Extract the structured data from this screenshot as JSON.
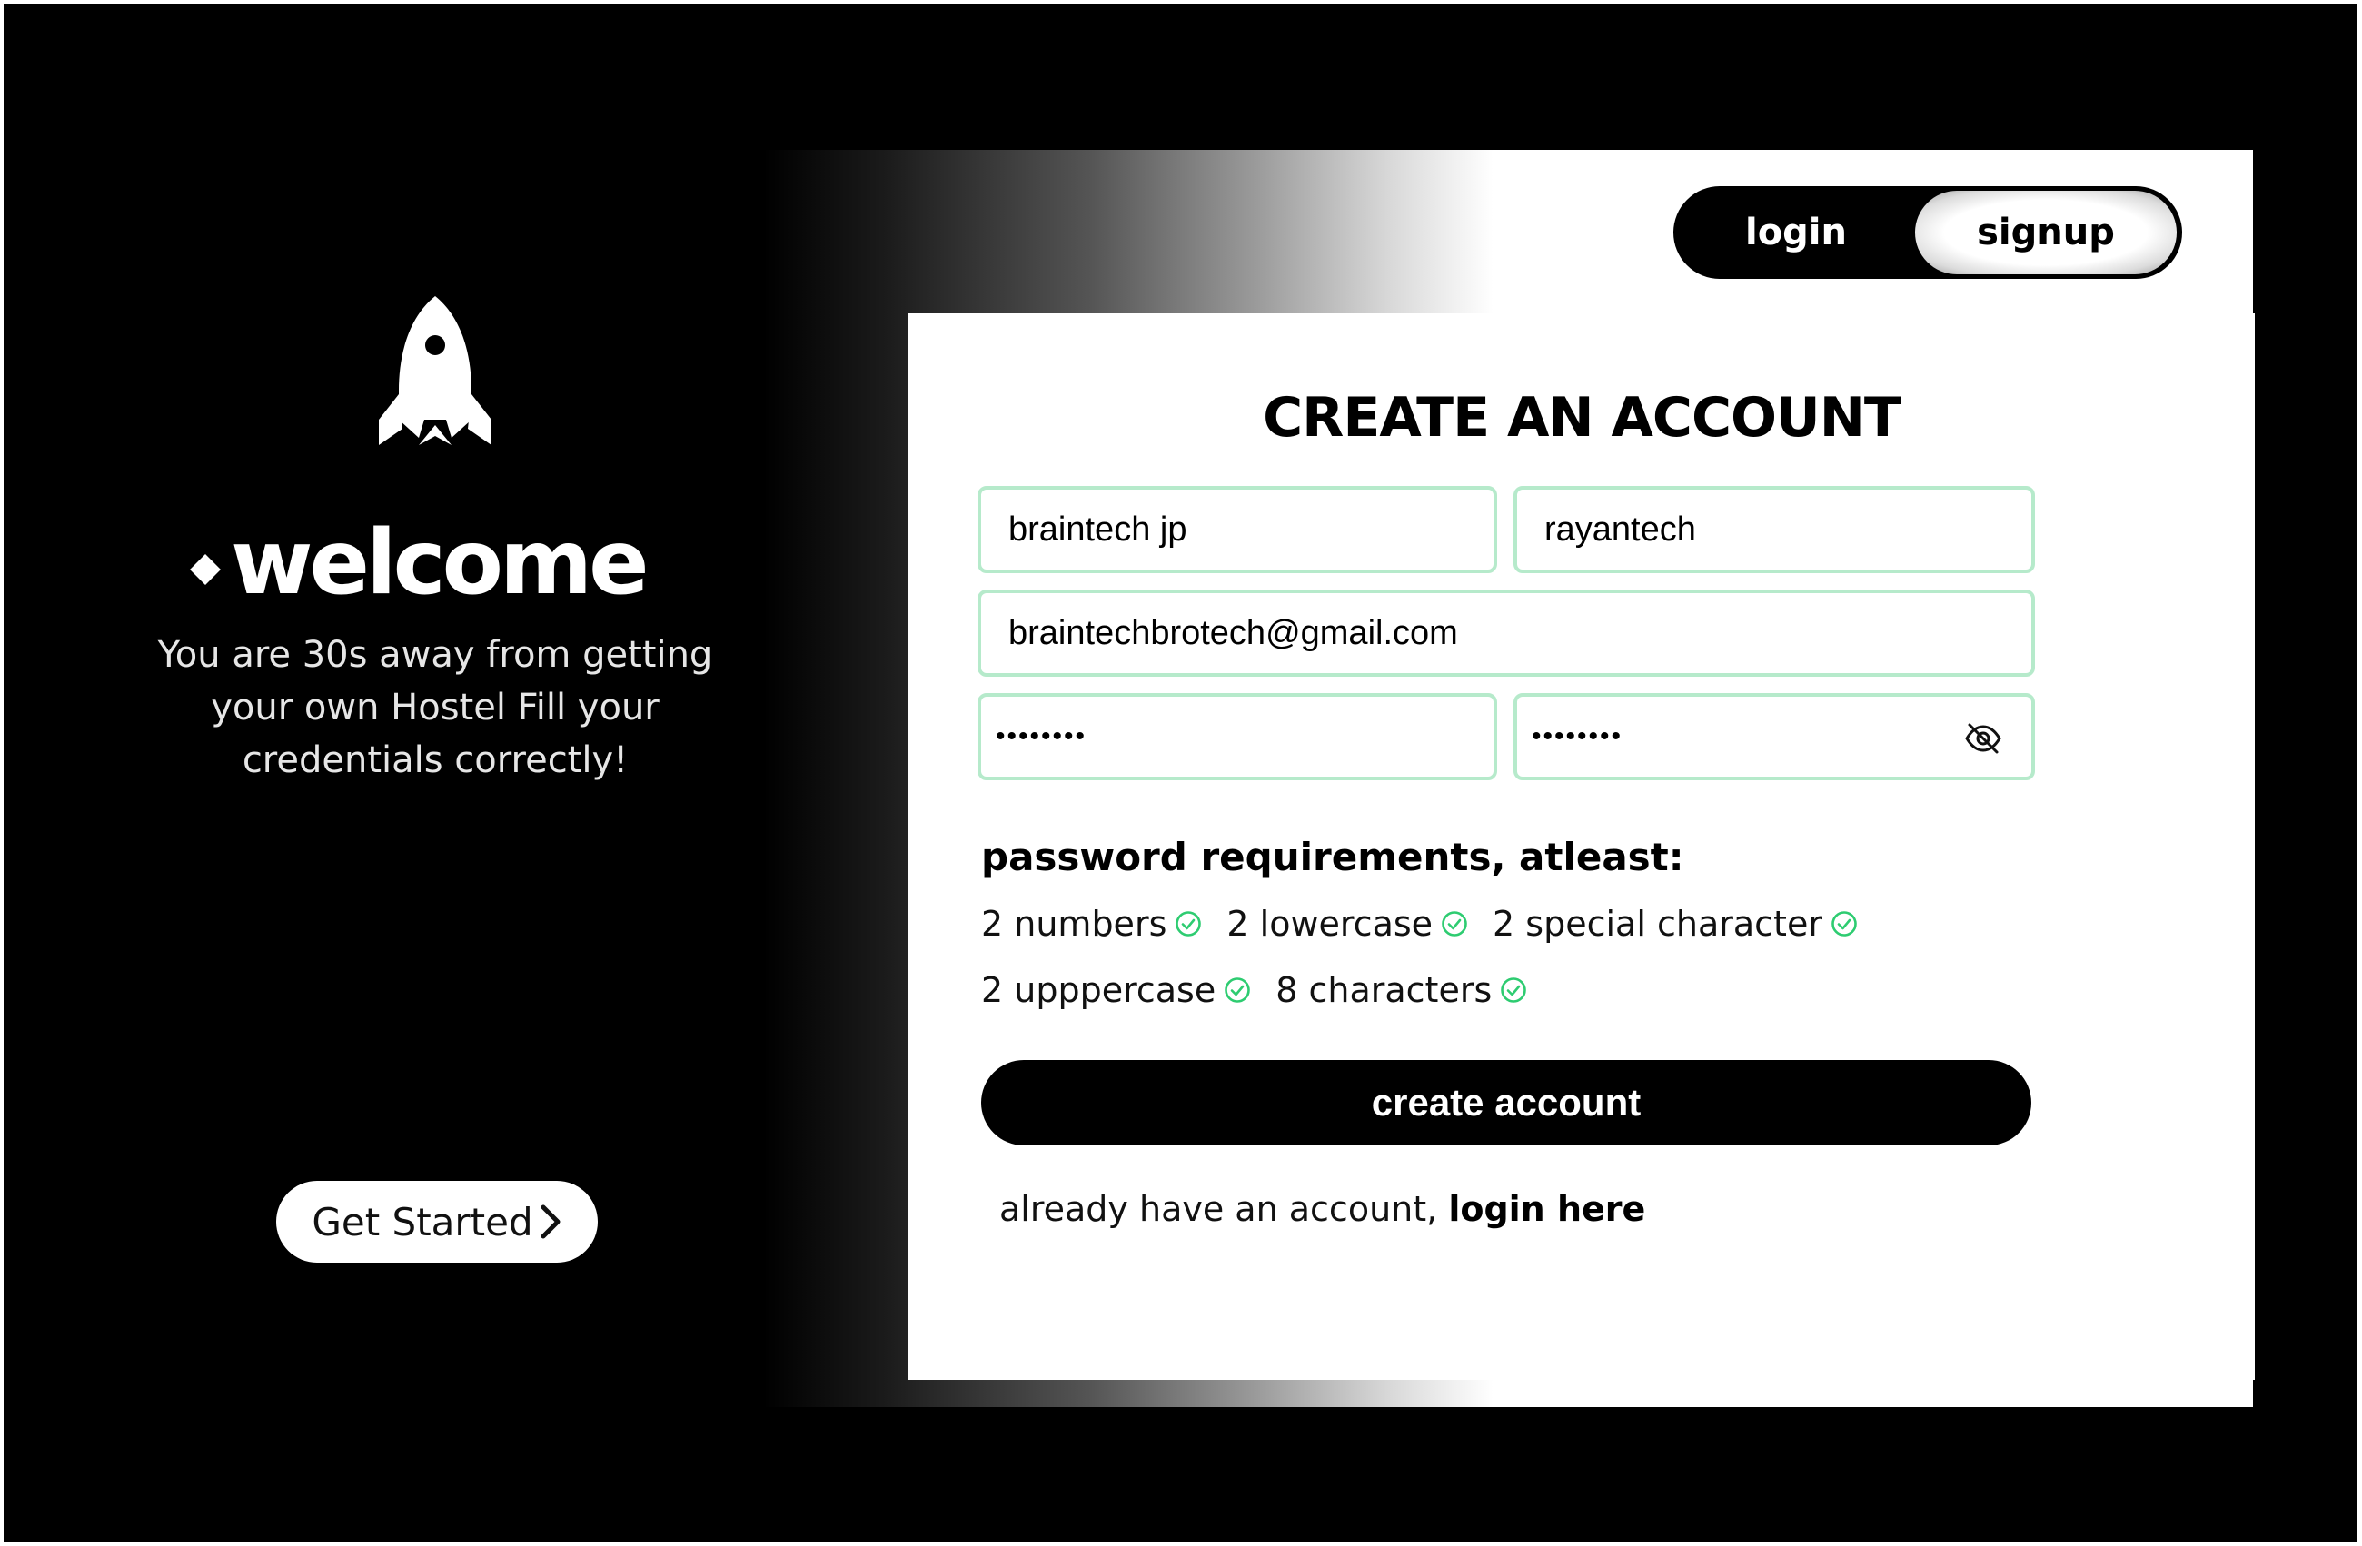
{
  "welcome": {
    "title": "welcome",
    "subtitle": "You are 30s away from getting your own Hostel Fill your credentials correctly!",
    "get_started_label": "Get Started"
  },
  "toggle": {
    "login_label": "login",
    "signup_label": "signup",
    "active": "signup"
  },
  "form": {
    "title": "CREATE AN ACCOUNT",
    "first_name_value": "braintech jp",
    "last_name_value": "rayantech",
    "email_value": "braintechbrotech@gmail.com",
    "password_value": "••••••••",
    "confirm_password_value": "••••••••",
    "requirements_title": "password requirements, atleast:",
    "requirements": [
      {
        "label": "2 numbers",
        "met": true
      },
      {
        "label": "2 lowercase",
        "met": true
      },
      {
        "label": "2 special character",
        "met": true
      },
      {
        "label": "2 upppercase",
        "met": true
      },
      {
        "label": "8 characters",
        "met": true
      }
    ],
    "submit_label": "create account",
    "already_text": "already have an account,",
    "login_link_label": "login here"
  },
  "colors": {
    "background": "#000000",
    "card": "#ffffff",
    "field_border": "#b6eacb",
    "check": "#2ecc71"
  },
  "icons": [
    "rocket-icon",
    "chevron-right-icon",
    "eye-slash-icon",
    "check-circle-icon"
  ]
}
